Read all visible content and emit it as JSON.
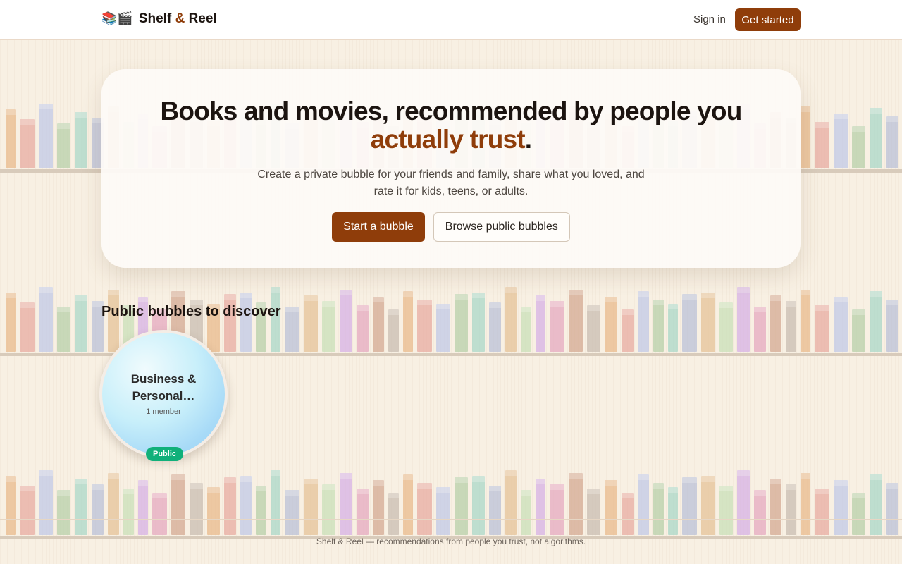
{
  "header": {
    "brand_icons": "📚🎬",
    "brand_part1": "Shelf",
    "brand_amp": "&",
    "brand_part2": "Reel",
    "sign_in": "Sign in",
    "get_started": "Get started"
  },
  "hero": {
    "title_main": "Books and movies, recommended by people you",
    "title_accent": "actually trust",
    "title_end": ".",
    "subtitle": "Create a private bubble for your friends and family, share what you loved, and rate it for kids, teens, or adults.",
    "primary_cta": "Start a bubble",
    "secondary_cta": "Browse public bubbles"
  },
  "public_bubbles": {
    "title": "Public bubbles to discover",
    "items": [
      {
        "name": "Business & Personal…",
        "members": "1 member",
        "badge": "Public"
      }
    ]
  },
  "footer": {
    "tagline": "Shelf & Reel — recommendations from people you trust, not algorithms."
  },
  "colors": {
    "accent": "#8f3d0a",
    "background": "#f8f0e3",
    "public_badge": "#10b07a"
  }
}
